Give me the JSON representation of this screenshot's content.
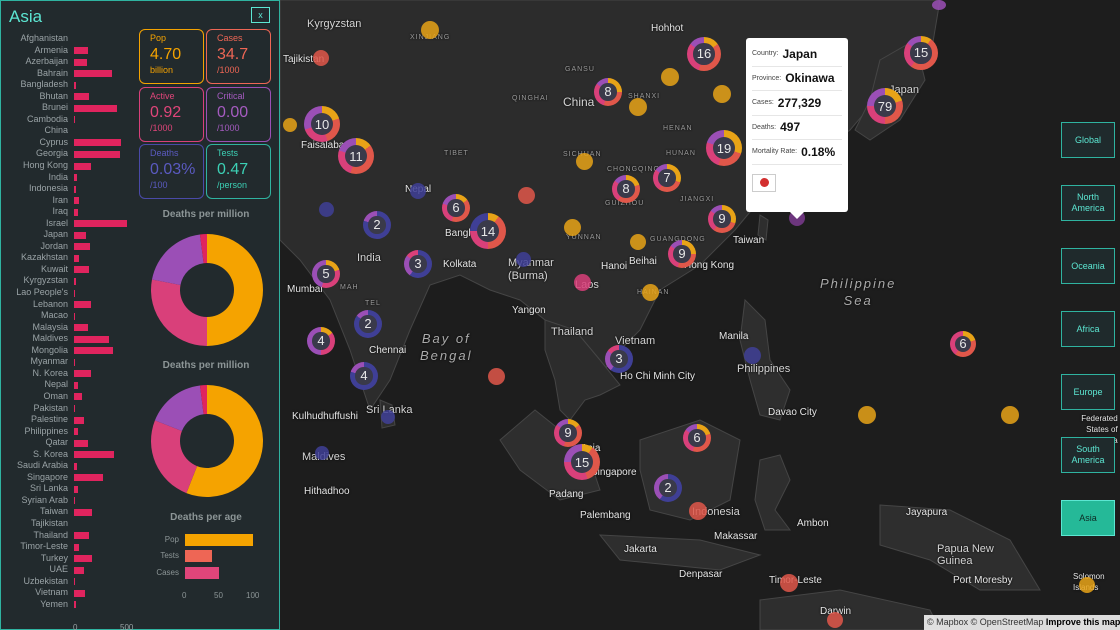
{
  "panel": {
    "title": "Asia",
    "close_label": "x",
    "countries": [
      {
        "name": "Afghanistan",
        "value": 0
      },
      {
        "name": "Armenia",
        "value": 14
      },
      {
        "name": "Azerbaijan",
        "value": 13
      },
      {
        "name": "Bahrain",
        "value": 37
      },
      {
        "name": "Bangladesh",
        "value": 2
      },
      {
        "name": "Bhutan",
        "value": 15
      },
      {
        "name": "Brunei",
        "value": 42
      },
      {
        "name": "Cambodia",
        "value": 1
      },
      {
        "name": "China",
        "value": 0
      },
      {
        "name": "Cyprus",
        "value": 46
      },
      {
        "name": "Georgia",
        "value": 45
      },
      {
        "name": "Hong Kong",
        "value": 17
      },
      {
        "name": "India",
        "value": 3
      },
      {
        "name": "Indonesia",
        "value": 2
      },
      {
        "name": "Iran",
        "value": 5
      },
      {
        "name": "Iraq",
        "value": 4
      },
      {
        "name": "Israel",
        "value": 52
      },
      {
        "name": "Japan",
        "value": 12
      },
      {
        "name": "Jordan",
        "value": 16
      },
      {
        "name": "Kazakhstan",
        "value": 5
      },
      {
        "name": "Kuwait",
        "value": 15
      },
      {
        "name": "Kyrgyzstan",
        "value": 2
      },
      {
        "name": "Lao People's",
        "value": 1
      },
      {
        "name": "Lebanon",
        "value": 17
      },
      {
        "name": "Macao",
        "value": 1
      },
      {
        "name": "Malaysia",
        "value": 14
      },
      {
        "name": "Maldives",
        "value": 34
      },
      {
        "name": "Mongolia",
        "value": 38
      },
      {
        "name": "Myanmar",
        "value": 1
      },
      {
        "name": "N. Korea",
        "value": 17
      },
      {
        "name": "Nepal",
        "value": 4
      },
      {
        "name": "Oman",
        "value": 8
      },
      {
        "name": "Pakistan",
        "value": 1
      },
      {
        "name": "Palestine",
        "value": 10
      },
      {
        "name": "Philippines",
        "value": 4
      },
      {
        "name": "Qatar",
        "value": 14
      },
      {
        "name": "S. Korea",
        "value": 39
      },
      {
        "name": "Saudi Arabia",
        "value": 3
      },
      {
        "name": "Singapore",
        "value": 28
      },
      {
        "name": "Sri Lanka",
        "value": 4
      },
      {
        "name": "Syrian Arab",
        "value": 1
      },
      {
        "name": "Taiwan",
        "value": 18
      },
      {
        "name": "Tajikistan",
        "value": 0
      },
      {
        "name": "Thailand",
        "value": 15
      },
      {
        "name": "Timor-Leste",
        "value": 5
      },
      {
        "name": "Turkey",
        "value": 18
      },
      {
        "name": "UAE",
        "value": 10
      },
      {
        "name": "Uzbekistan",
        "value": 1
      },
      {
        "name": "Vietnam",
        "value": 11
      },
      {
        "name": "Yemen",
        "value": 2
      }
    ],
    "list_axis": [
      "0",
      "500"
    ],
    "stats": {
      "pop": {
        "label": "Pop",
        "value": "4.70",
        "unit": "billion"
      },
      "cases": {
        "label": "Cases",
        "value": "34.7",
        "unit": "/1000"
      },
      "active": {
        "label": "Active",
        "value": "0.92",
        "unit": "/1000"
      },
      "critical": {
        "label": "Critical",
        "value": "0.00",
        "unit": "/1000"
      },
      "deaths": {
        "label": "Deaths",
        "value": "0.03%",
        "unit": "/100"
      },
      "tests": {
        "label": "Tests",
        "value": "0.47",
        "unit": "/person"
      }
    },
    "donut_titles": [
      "Deaths per million",
      "Deaths per million"
    ],
    "donuts": [
      [
        {
          "share": 0.5,
          "color": "#f5a300"
        },
        {
          "share": 0.28,
          "color": "#d9407a"
        },
        {
          "share": 0.2,
          "color": "#9b4fb6"
        },
        {
          "share": 0.02,
          "color": "#e0245e"
        }
      ],
      [
        {
          "share": 0.56,
          "color": "#f5a300"
        },
        {
          "share": 0.25,
          "color": "#d9407a"
        },
        {
          "share": 0.17,
          "color": "#9b4fb6"
        },
        {
          "share": 0.02,
          "color": "#e0245e"
        }
      ]
    ],
    "age_title": "Deaths per age",
    "age_rows": [
      {
        "label": "Pop",
        "value": 100,
        "color": "#f5a300"
      },
      {
        "label": "Tests",
        "value": 40,
        "color": "#ee6655"
      },
      {
        "label": "Cases",
        "value": 50,
        "color": "#e0457a"
      }
    ],
    "age_axis": [
      "0",
      "50",
      "100"
    ]
  },
  "popup": {
    "country_key": "Country:",
    "country": "Japan",
    "province_key": "Province:",
    "province": "Okinawa",
    "cases_key": "Cases:",
    "cases": "277,329",
    "deaths_key": "Deaths:",
    "deaths": "497",
    "mortality_key": "Mortality Rate:",
    "mortality": "0.18%",
    "flag_icon": "japan-flag-icon"
  },
  "regions": [
    "Global",
    "North America",
    "Oceania",
    "Africa",
    "Europe",
    "South America",
    "Asia"
  ],
  "active_region": "Asia",
  "attribution": {
    "mapbox": "© Mapbox",
    "osm": "© OpenStreetMap",
    "improve": "Improve this map"
  },
  "map_labels": {
    "kyrgyzstan": "Kyrgyzstan",
    "tajikistan": "Tajikistan",
    "xinjiang": "XINJIANG",
    "gansu": "GANSU",
    "china": "China",
    "hohhot": "Hohhot",
    "qinghai": "QINGHAI",
    "shanxi": "SHANXI",
    "henan": "HENAN",
    "japan": "Japan",
    "faisalabad": "Faisalabad",
    "tibet": "TIBET",
    "sichuan": "SICHUAN",
    "chongqing": "CHONGQING",
    "jiangxi": "JIANGXI",
    "nepal": "Nepal",
    "taiwan": "Taiwan",
    "guizhou": "GUIZHOU",
    "bangladesh": "Bangl",
    "yunnan": "YUNNAN",
    "guangdong": "GUANGDONG",
    "india": "India",
    "kolkata": "Kolkata",
    "myanmar": "Myanmar\n(Burma)",
    "hanoi": "Hanoi",
    "beihai": "Beihai",
    "hong_kong": "Hong Kong",
    "laos": "Laos",
    "hainan": "HAINAN",
    "mumbai": "Mumbai",
    "yangon": "Yangon",
    "thailand": "Thailand",
    "vietnam": "Vietnam",
    "bay_of_bengal": "Bay of\nBengal",
    "chennai": "Chennai",
    "manila": "Manila",
    "philippine_sea": "Philippine\nSea",
    "philippines": "Philippines",
    "ho_chi_minh": "Ho Chi Minh City",
    "sri_lanka": "Sri Lanka",
    "kulhudhuffushi": "Kulhudhuffushi",
    "davao": "Davao City",
    "maldives": "Maldives",
    "singapore": "Singapore",
    "hithadhoo": "Hithadhoo",
    "padang": "Padang",
    "micronesia": "Federated\nStates of\nMicronesia",
    "indonesia": "Indonesia",
    "palembang": "Palembang",
    "ambon": "Ambon",
    "jayapura": "Jayapura",
    "makassar": "Makassar",
    "jakarta": "Jakarta",
    "papua": "Papua New\nGuinea",
    "denpasar": "Denpasar",
    "timor": "Timor-Leste",
    "port_moresby": "Port Moresby",
    "solomon": "Solomon\nIslands",
    "darwin": "Darwin",
    "asia": "Asia",
    "tel": "TEL",
    "mah": "MAH",
    "kar": "KA",
    "hunan": "HUNAN"
  },
  "clusters": [
    {
      "count": "16"
    },
    {
      "count": "15"
    },
    {
      "count": "8"
    },
    {
      "count": "79"
    },
    {
      "count": "10"
    },
    {
      "count": "11"
    },
    {
      "count": "19"
    },
    {
      "count": "8"
    },
    {
      "count": "7"
    },
    {
      "count": "6"
    },
    {
      "count": "14"
    },
    {
      "count": "9"
    },
    {
      "count": "2"
    },
    {
      "count": "3"
    },
    {
      "count": "5"
    },
    {
      "count": "9"
    },
    {
      "count": "2"
    },
    {
      "count": "4"
    },
    {
      "count": "3"
    },
    {
      "count": "4"
    },
    {
      "count": "6"
    },
    {
      "count": "9"
    },
    {
      "count": "15"
    },
    {
      "count": "6"
    },
    {
      "count": "2"
    }
  ]
}
